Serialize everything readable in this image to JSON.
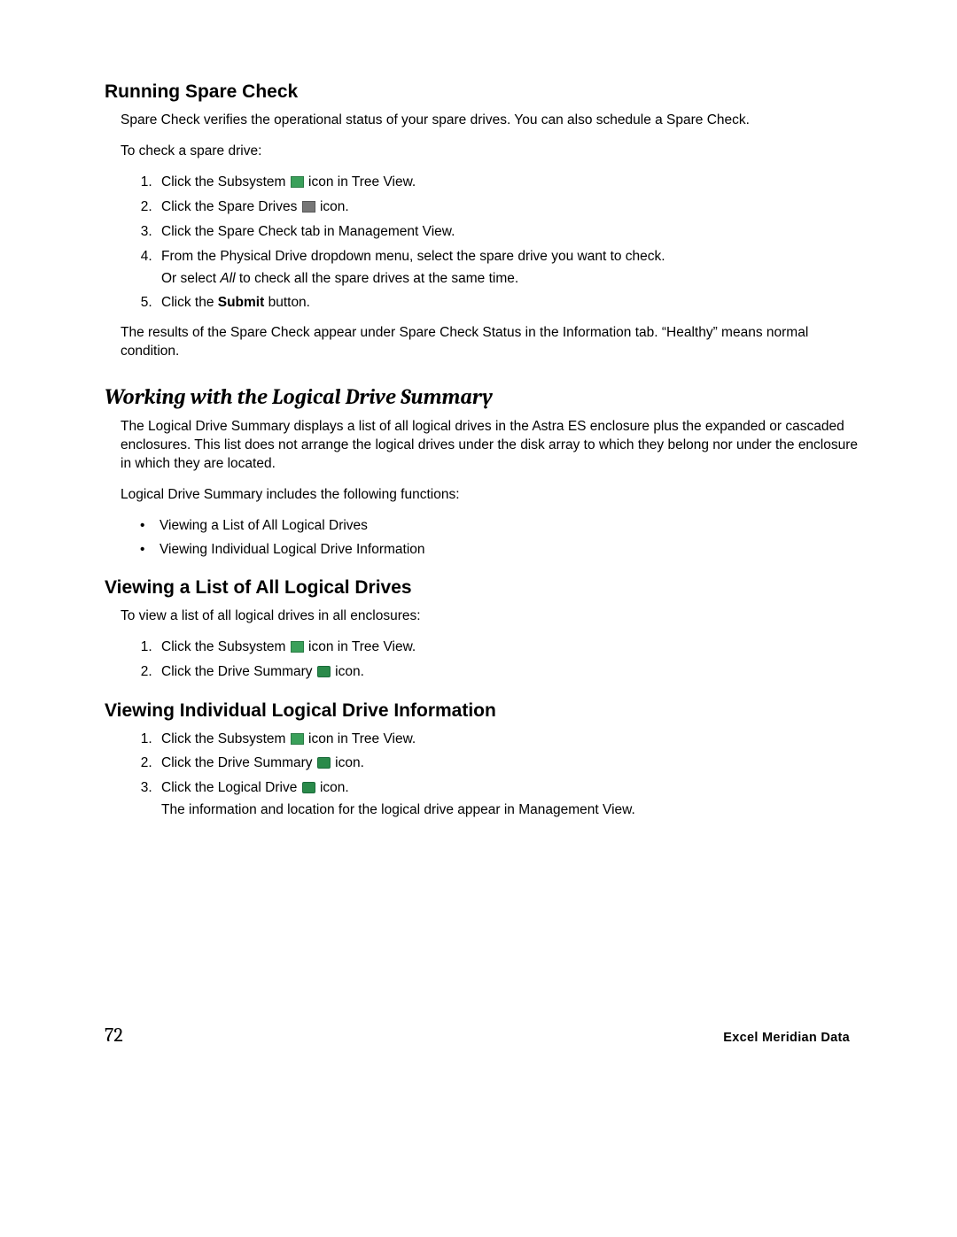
{
  "sections": {
    "spare_check": {
      "title": "Running Spare Check",
      "intro": "Spare Check verifies the operational status of your spare drives. You can also schedule a Spare Check.",
      "lead": "To check a spare drive:",
      "steps": {
        "s1a": "Click the Subsystem ",
        "s1b": " icon in Tree View.",
        "s2a": "Click the Spare Drives ",
        "s2b": " icon.",
        "s3": "Click the Spare Check tab in Management View.",
        "s4": "From the Physical Drive dropdown menu, select the spare drive you want to check.",
        "s4b_pre": "Or select ",
        "s4b_italic": "All",
        "s4b_post": " to check all the spare drives at the same time.",
        "s5a": "Click the ",
        "s5b_bold": "Submit",
        "s5c": " button."
      },
      "result": "The results of the Spare Check appear under Spare Check Status in the Information tab. “Healthy” means normal condition."
    },
    "logical_summary": {
      "title": "Working with the Logical Drive Summary",
      "intro": "The Logical Drive Summary displays a list of all logical drives in the Astra ES enclosure plus the expanded or cascaded enclosures. This list does not arrange the logical drives under the disk array to which they belong nor under the enclosure in which they are located.",
      "lead": "Logical Drive Summary includes the following functions:",
      "bullets": [
        "Viewing a List of All Logical Drives",
        "Viewing Individual Logical Drive Information"
      ]
    },
    "view_list": {
      "title": "Viewing a List of All Logical Drives",
      "lead": "To view a list of all logical drives in all enclosures:",
      "steps": {
        "s1a": "Click the Subsystem ",
        "s1b": " icon in Tree View.",
        "s2a": "Click the Drive Summary ",
        "s2b": " icon."
      }
    },
    "view_individual": {
      "title": "Viewing Individual Logical Drive Information",
      "steps": {
        "s1a": "Click the Subsystem ",
        "s1b": " icon in Tree View.",
        "s2a": "Click the Drive Summary ",
        "s2b": " icon.",
        "s3a": "Click the Logical Drive ",
        "s3b": " icon.",
        "s3c": "The information and location for the logical drive appear in Management View."
      }
    }
  },
  "footer": {
    "page_number": "72",
    "brand": "Excel Meridian Data"
  }
}
